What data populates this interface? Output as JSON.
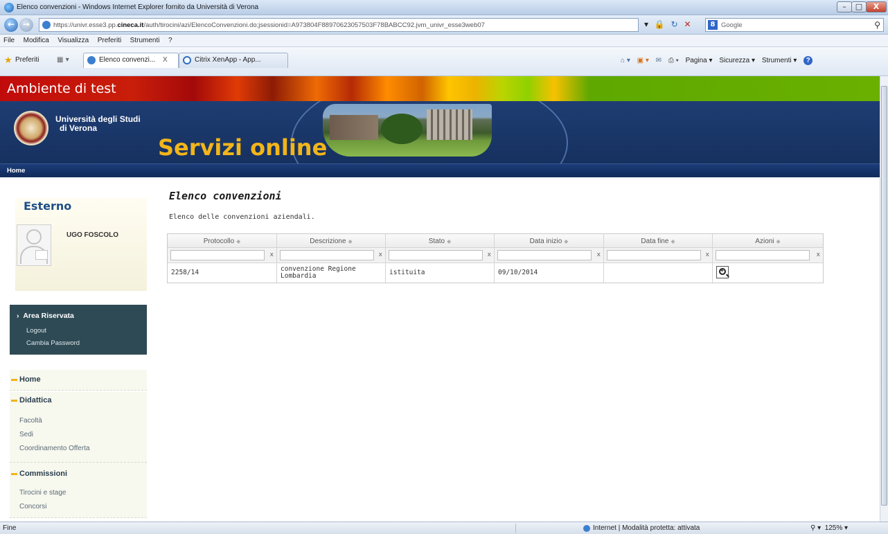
{
  "window": {
    "title": "Elenco convenzioni - Windows Internet Explorer fornito da Università di Verona",
    "min_label": "–",
    "max_label": "□",
    "close_label": "X"
  },
  "address": {
    "url_prefix": "https://univr.esse3.pp.",
    "url_host": "cineca.it",
    "url_path": "/auth/tirocini/azi/ElencoConvenzioni.do;jsessionid=A973804F88970623057503F78BABCC92.jvm_univr_esse3web07",
    "search_placeholder": "Google",
    "search_logo": "8"
  },
  "menubar": {
    "items": [
      "File",
      "Modifica",
      "Visualizza",
      "Preferiti",
      "Strumenti",
      "?"
    ]
  },
  "favbar": {
    "favorites_label": "Preferiti",
    "tabs": [
      {
        "label": "Elenco convenzi...",
        "close": "X"
      },
      {
        "label": "Citrix XenApp - App..."
      }
    ],
    "commands": {
      "page": "Pagina ▾",
      "security": "Sicurezza ▾",
      "tools": "Strumenti ▾",
      "help": "?"
    }
  },
  "site": {
    "env_title": "Ambiente di test",
    "uni_line1": "Università degli Studi",
    "uni_line2": "di Verona",
    "service_title": "Servizi online",
    "home_link": "Home"
  },
  "sidebar": {
    "role": "Esterno",
    "user_name": "UGO FOSCOLO",
    "reserved_title": "Area Riservata",
    "reserved_links": [
      "Logout",
      "Cambia Password"
    ],
    "menu": {
      "home": "Home",
      "didattica": "Didattica",
      "didattica_items": [
        "Facoltà",
        "Sedi",
        "Coordinamento Offerta"
      ],
      "commissioni": "Commissioni",
      "commissioni_items": [
        "Tirocini e stage",
        "Concorsi"
      ]
    }
  },
  "main": {
    "heading": "Elenco convenzioni",
    "description": "Elenco delle convenzioni aziendali.",
    "columns": [
      "Protocollo",
      "Descrizione",
      "Stato",
      "Data inizio",
      "Data fine",
      "Azioni"
    ],
    "rows": [
      {
        "protocollo": "2258/14",
        "descrizione": "convenzione Regione Lombardia",
        "stato": "istituita",
        "data_inizio": "09/10/2014",
        "data_fine": ""
      }
    ]
  },
  "statusbar": {
    "status": "Fine",
    "zone": "Internet | Modalità protetta: attivata",
    "zoom": "125%"
  }
}
